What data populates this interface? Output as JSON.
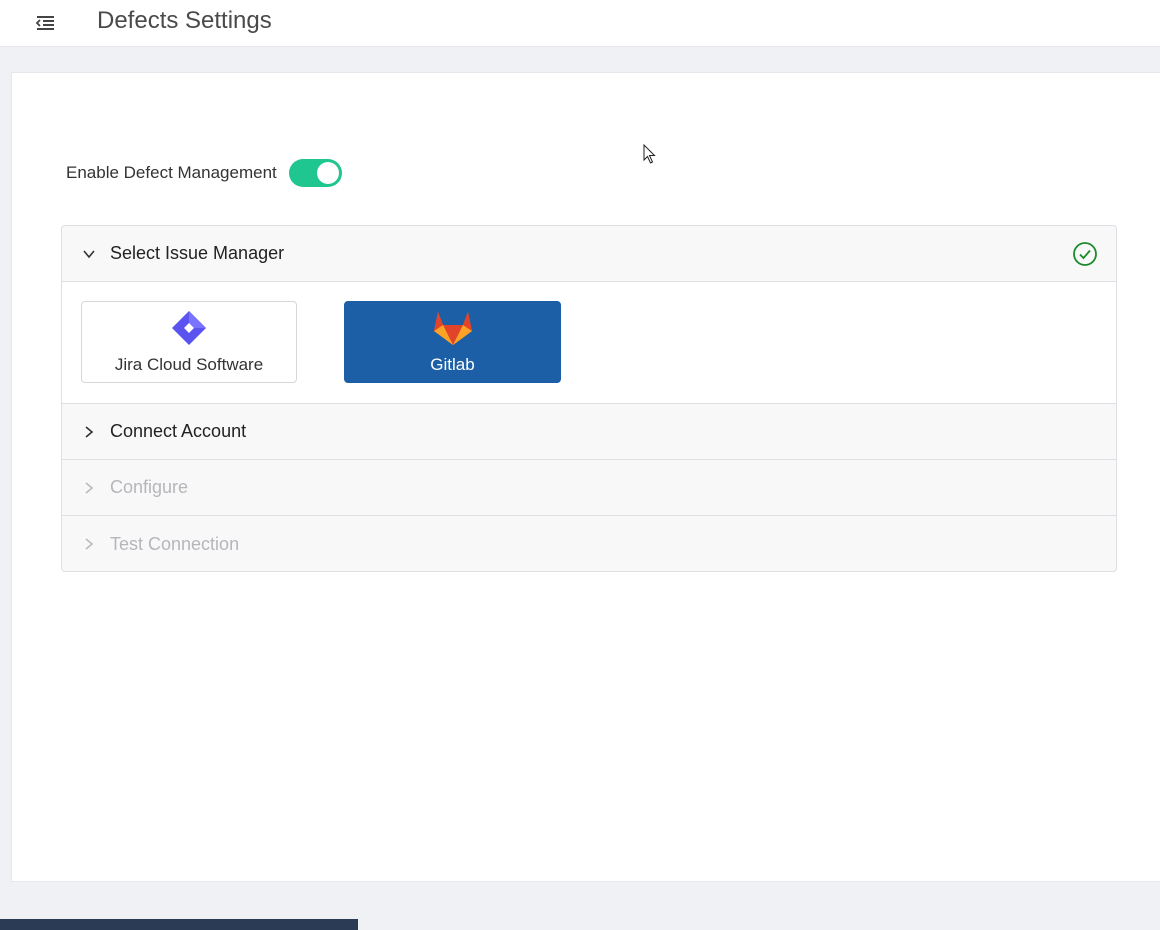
{
  "header": {
    "title": "Defects Settings",
    "menu_icon": "menu-collapse-icon"
  },
  "defect_management": {
    "toggle_label": "Enable Defect Management",
    "enabled": true,
    "toggle_color": "#1fc690"
  },
  "accordion": {
    "sections": [
      {
        "title": "Select Issue Manager",
        "expanded": true,
        "completed": true,
        "disabled": false
      },
      {
        "title": "Connect Account",
        "expanded": false,
        "completed": false,
        "disabled": false
      },
      {
        "title": "Configure",
        "expanded": false,
        "completed": false,
        "disabled": true
      },
      {
        "title": "Test Connection",
        "expanded": false,
        "completed": false,
        "disabled": true
      }
    ],
    "issue_managers": [
      {
        "label": "Jira Cloud Software",
        "icon": "jira-icon",
        "selected": false
      },
      {
        "label": "Gitlab",
        "icon": "gitlab-icon",
        "selected": true
      }
    ],
    "selected_color": "#1c5fa6",
    "check_color": "#1a8a2c"
  }
}
